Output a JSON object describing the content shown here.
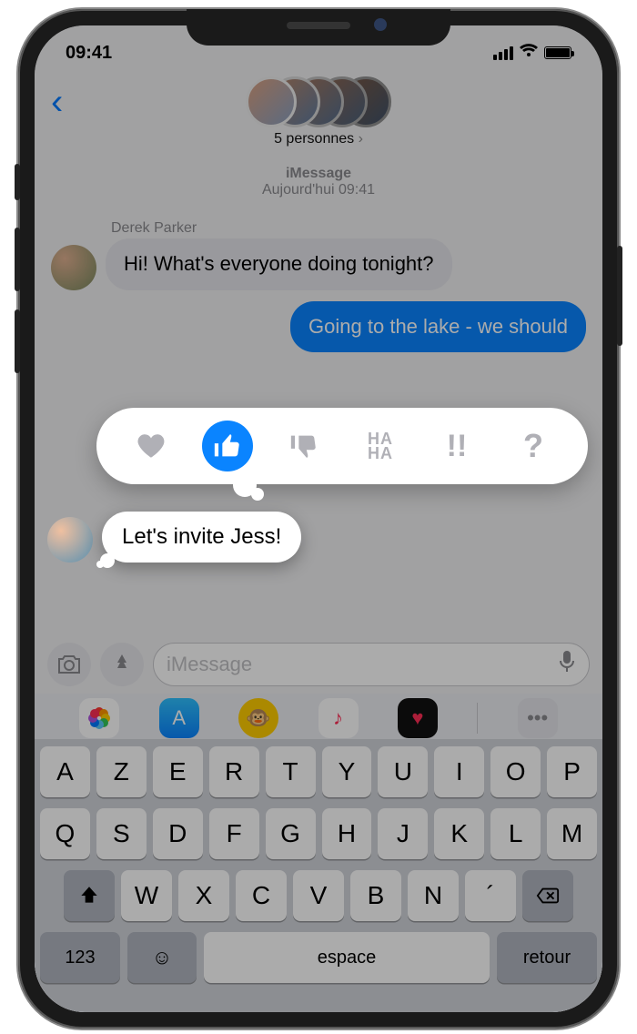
{
  "status": {
    "time": "09:41"
  },
  "header": {
    "group_label": "5 personnes",
    "chevron": "›"
  },
  "thread_meta": {
    "service": "iMessage",
    "timestamp": "Aujourd'hui 09:41"
  },
  "messages": {
    "m1_sender": "Derek Parker",
    "m1_text": "Hi! What's everyone doing tonight?",
    "m2_text": "Going to the lake - we should",
    "m3_text": "Let's invite Jess!"
  },
  "tapback": {
    "heart": "♥",
    "thumbs_up": "👍",
    "thumbs_down": "👎",
    "haha": "HA\nHA",
    "exclaim": "!!",
    "question": "?",
    "selected": "thumbs_up"
  },
  "compose": {
    "placeholder": "iMessage"
  },
  "keyboard": {
    "row1": [
      "A",
      "Z",
      "E",
      "R",
      "T",
      "Y",
      "U",
      "I",
      "O",
      "P"
    ],
    "row2": [
      "Q",
      "S",
      "D",
      "F",
      "G",
      "H",
      "J",
      "K",
      "L",
      "M"
    ],
    "row3": [
      "W",
      "X",
      "C",
      "V",
      "B",
      "N",
      "´"
    ],
    "num_label": "123",
    "space_label": "espace",
    "return_label": "retour"
  }
}
